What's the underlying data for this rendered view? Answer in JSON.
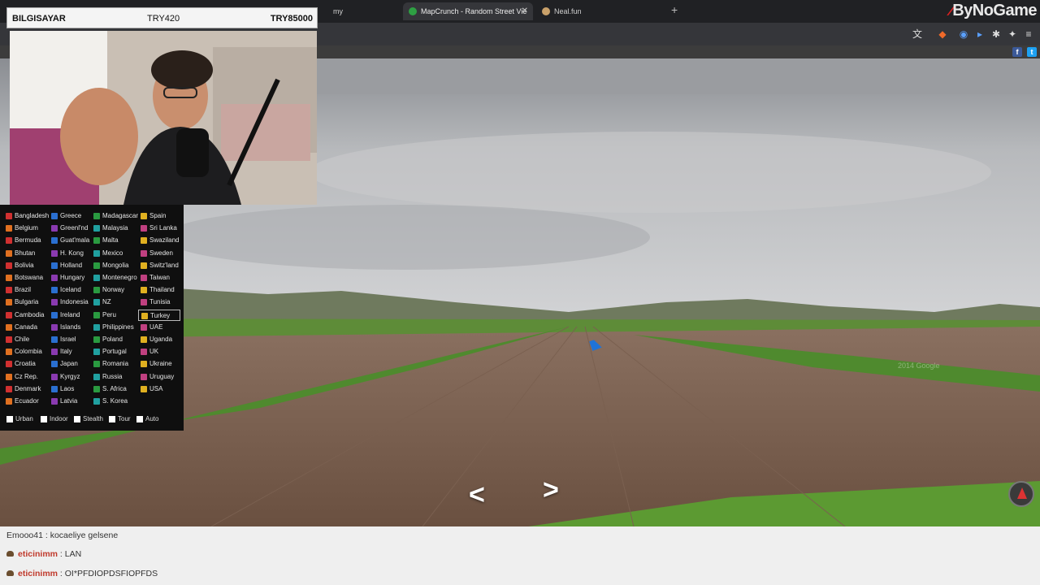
{
  "overlay": {
    "player_label": "BILGISAYAR",
    "score_left": "TRY420",
    "score_right": "TRY85000",
    "brand": "ByNoGame",
    "icon": "webcam-feed"
  },
  "browser": {
    "tabs": [
      {
        "label": "my",
        "active": false
      },
      {
        "label": "MapCrunch - Random Street Vie",
        "active": true,
        "icon": "mapcrunch-icon"
      },
      {
        "label": "Neal.fun",
        "active": false,
        "icon": "nealfun-icon"
      }
    ],
    "new_tab_glyph": "+",
    "close_glyph": "✕"
  },
  "countries": [
    [
      "Bangladesh",
      "Greece",
      "Madagascar",
      "Spain"
    ],
    [
      "Belgium",
      "Greenl'nd",
      "Malaysia",
      "Sri Lanka"
    ],
    [
      "Bermuda",
      "Guat'mala",
      "Malta",
      "Swaziland"
    ],
    [
      "Bhutan",
      "H. Kong",
      "Mexico",
      "Sweden"
    ],
    [
      "Bolivia",
      "Holland",
      "Mongolia",
      "Switz'land"
    ],
    [
      "Botswana",
      "Hungary",
      "Montenegro",
      "Taiwan"
    ],
    [
      "Brazil",
      "Iceland",
      "Norway",
      "Thailand"
    ],
    [
      "Bulgaria",
      "Indonesia",
      "NZ",
      "Tunisia"
    ],
    [
      "Cambodia",
      "Ireland",
      "Peru",
      "Turkey"
    ],
    [
      "Canada",
      "Islands",
      "Philippines",
      "UAE"
    ],
    [
      "Chile",
      "Israel",
      "Poland",
      "Uganda"
    ],
    [
      "Colombia",
      "Italy",
      "Portugal",
      "UK"
    ],
    [
      "Croatia",
      "Japan",
      "Romania",
      "Ukraine"
    ],
    [
      "Cz Rep.",
      "Kyrgyz",
      "Russia",
      "Uruguay"
    ],
    [
      "Denmark",
      "Laos",
      "S. Africa",
      "USA"
    ],
    [
      "Ecuador",
      "Latvia",
      "S. Korea",
      ""
    ]
  ],
  "selected_country": "Turkey",
  "options": [
    "Urban",
    "Indoor",
    "Stealth",
    "Tour",
    "Auto"
  ],
  "street_view": {
    "arrow_left": "<",
    "arrow_right": ">",
    "watermark": "2014 Google"
  },
  "chat": [
    {
      "user": "",
      "text": "Emooo41 : kocaeliye gelsene"
    },
    {
      "user": "eticinimm",
      "text": " : LAN"
    },
    {
      "user": "eticinimm",
      "text": " : OI*PFDIOPDSFIOPFDS"
    }
  ],
  "colors": {
    "accent_red": "#e02020",
    "panel_bg": "#0f0f0f",
    "chat_user": "#c0392b"
  }
}
